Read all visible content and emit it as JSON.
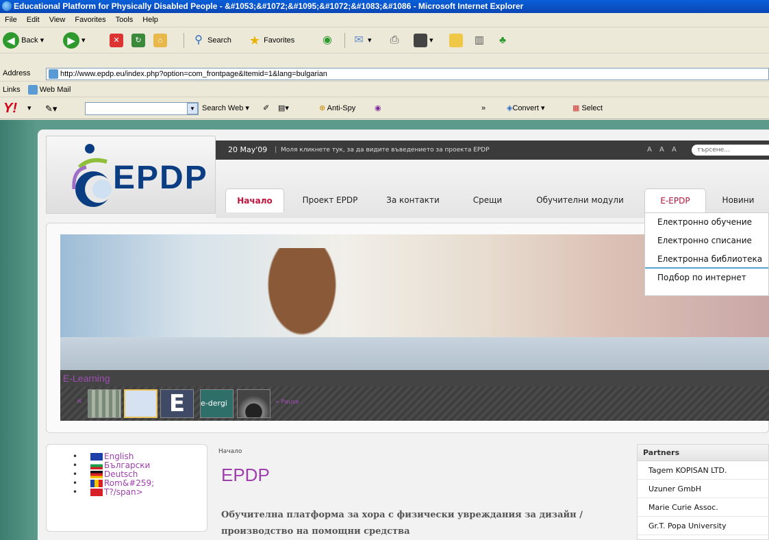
{
  "window": {
    "title": "Educational Platform for Physically Disabled People - &#1053;&#1072;&#1095;&#1072;&#1083;&#1086 - Microsoft Internet Explorer"
  },
  "menu": [
    "File",
    "Edit",
    "View",
    "Favorites",
    "Tools",
    "Help"
  ],
  "toolbar": {
    "back": "Back",
    "search": "Search",
    "favorites": "Favorites"
  },
  "address": {
    "label": "Address",
    "url": "http://www.epdp.eu/index.php?option=com_frontpage&Itemid=1&lang=bulgarian"
  },
  "links": {
    "label": "Links",
    "webmail": "Web Mail"
  },
  "yahoo": {
    "search_web": "Search Web",
    "anti_spy": "Anti-Spy",
    "convert": "Convert",
    "select": "Select",
    "chevron": "»"
  },
  "site": {
    "logo": "EPDP",
    "date": "20 May'09",
    "topmsg": "Моля кликнете тук, за да видите въведението за проекта EPDP",
    "font_sizes": "A A A",
    "search_placeholder": "търсене...",
    "nav": [
      "Начало",
      "Проект EPDP",
      "За контакти",
      "Срещи",
      "Обучителни модули",
      "E-EPDP",
      "Новини"
    ],
    "dropdown": [
      "Електронно обучение",
      "Електронно списание",
      "Електронна библиотека",
      "Подбор по интернет"
    ],
    "slider_caption": "E-Learning",
    "slider_thumb_text": "e-dergi",
    "slider_pause": "» Pause",
    "slider_prev": "«",
    "languages": [
      "English",
      "Български",
      "Deutsch",
      "Rom&#259;",
      "T?/span>"
    ],
    "breadcrumb": "Начало",
    "article_title": "EPDP",
    "article_sub": "Обучителна платформа за хора с физически увреждания за дизайн / производство на помощни средства",
    "partners_title": "Partners",
    "partners": [
      "Tagem KOPISAN LTD.",
      "Uzuner GmbH",
      "Marie Curie Assoc.",
      "Gr.T. Popa University"
    ]
  }
}
